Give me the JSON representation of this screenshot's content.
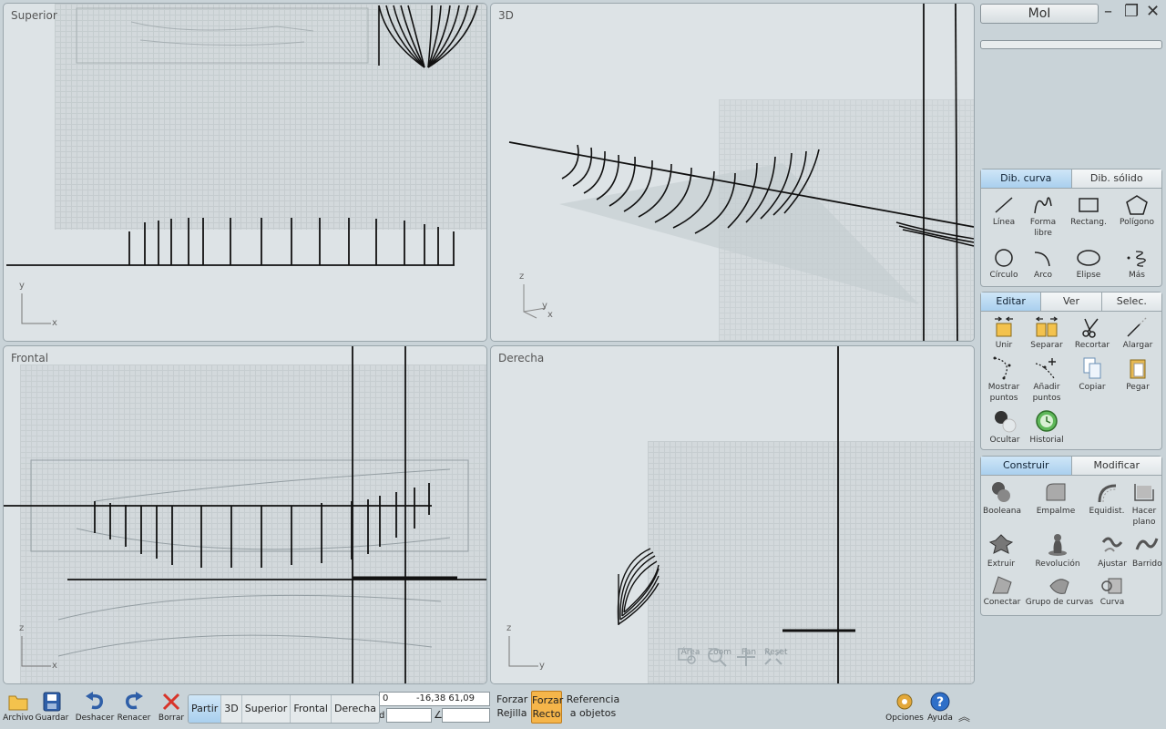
{
  "viewports": {
    "top": {
      "title": "Superior",
      "axis_v": "y",
      "axis_h": "x"
    },
    "three_d": {
      "title": "3D",
      "axis_v": "z",
      "axis_h": "y",
      "axis_h2": "x"
    },
    "front": {
      "title": "Frontal",
      "axis_v": "z",
      "axis_h": "x"
    },
    "right": {
      "title": "Derecha",
      "axis_v": "z",
      "axis_h": "y"
    }
  },
  "right_view_nav": {
    "area": "Área",
    "zoom": "Zoom",
    "pan": "Pan",
    "reset": "Reset"
  },
  "panel": {
    "app_title": "MoI",
    "draw_group": {
      "tabs": [
        "Dib. curva",
        "Dib. sólido"
      ],
      "tools": [
        "Línea",
        "Forma libre",
        "Rectang.",
        "Polígono",
        "Círculo",
        "Arco",
        "Elipse",
        "Más"
      ]
    },
    "edit_group": {
      "tabs": [
        "Editar",
        "Ver",
        "Selec."
      ],
      "tools": [
        "Unir",
        "Separar",
        "Recortar",
        "Alargar",
        "Mostrar puntos",
        "Añadir puntos",
        "Copiar",
        "Pegar",
        "Ocultar",
        "Historial"
      ]
    },
    "construct_group": {
      "tabs": [
        "Construir",
        "Modificar"
      ],
      "tools": [
        "Booleana",
        "Empalme",
        "Equidist.",
        "Hacer plano",
        "Extruir",
        "Revolución",
        "Ajustar",
        "Barrido",
        "Conectar",
        "Grupo de curvas",
        "Curva"
      ]
    }
  },
  "bottom": {
    "file": "Archivo",
    "save": "Guardar",
    "undo": "Deshacer",
    "redo": "Renacer",
    "delete": "Borrar",
    "views": [
      "Partir",
      "3D",
      "Superior",
      "Frontal",
      "Derecha"
    ],
    "coord_x": "0",
    "coord_yz": "-16,38  61,09",
    "dist_label": "d",
    "angle_label": "∠",
    "snap_grid": [
      "Forzar",
      "Rejilla"
    ],
    "snap_straight": [
      "Forzar",
      "Recto"
    ],
    "snap_objects": [
      "Referencia",
      "a objetos"
    ],
    "options": "Opciones",
    "help": "Ayuda"
  },
  "colors": {
    "accent": "#a9cfee",
    "snap_on": "#f5b54a",
    "viewport_bg": "#dde3e6"
  }
}
